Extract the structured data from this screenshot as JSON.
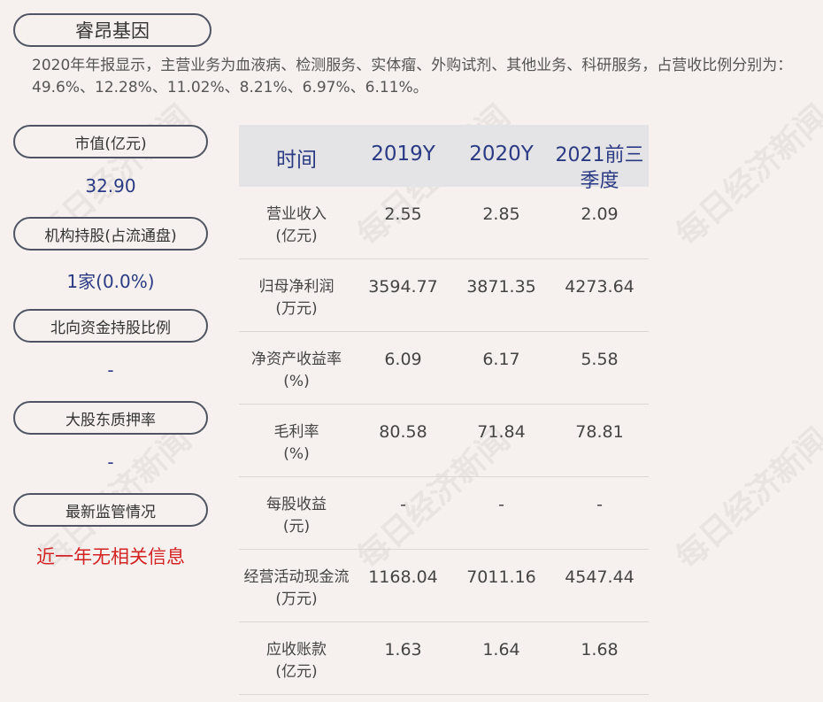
{
  "company": "睿昂基因",
  "intro": "2020年年报显示，主营业务为血液病、检测服务、实体瘤、外购试剂、其他业务、科研服务，占营收比例分别为：49.6%、12.28%、11.02%、8.21%、6.97%、6.11%。",
  "sidebar": [
    {
      "label": "市值(亿元)",
      "value": "32.90"
    },
    {
      "label": "机构持股(占流通盘)",
      "value": "1家(0.0%)"
    },
    {
      "label": "北向资金持股比例",
      "value": "-"
    },
    {
      "label": "大股东质押率",
      "value": "-"
    },
    {
      "label": "最新监管情况",
      "value": "近一年无相关信息"
    }
  ],
  "table": {
    "headers": [
      "时间",
      "2019Y",
      "2020Y",
      "2021前三季度"
    ],
    "rows": [
      {
        "label": "营业收入(亿元)",
        "label1": "营业收入",
        "label2": "(亿元)",
        "values": [
          "2.55",
          "2.85",
          "2.09"
        ]
      },
      {
        "label": "归母净利润(万元)",
        "label1": "归母净利润",
        "label2": "(万元)",
        "values": [
          "3594.77",
          "3871.35",
          "4273.64"
        ]
      },
      {
        "label": "净资产收益率(%)",
        "label1": "净资产收益率",
        "label2": "(%)",
        "values": [
          "6.09",
          "6.17",
          "5.58"
        ]
      },
      {
        "label": "毛利率(%)",
        "label1": "毛利率",
        "label2": "(%)",
        "values": [
          "80.58",
          "71.84",
          "78.81"
        ]
      },
      {
        "label": "每股收益(元)",
        "label1": "每股收益",
        "label2": "(元)",
        "values": [
          "-",
          "-",
          "-"
        ]
      },
      {
        "label": "经营活动现金流(万元)",
        "label1": "经营活动现金流",
        "label2": "(万元)",
        "values": [
          "1168.04",
          "7011.16",
          "4547.44"
        ]
      },
      {
        "label": "应收账款(亿元)",
        "label1": "应收账款",
        "label2": "(亿元)",
        "values": [
          "1.63",
          "1.64",
          "1.68"
        ]
      }
    ]
  },
  "watermark": "每日经济新闻",
  "colors": {
    "background": "#f6f1ee",
    "accent_blue": "#2a3a84",
    "alert_red": "#d22222",
    "header_bg": "#e4e3e5"
  }
}
